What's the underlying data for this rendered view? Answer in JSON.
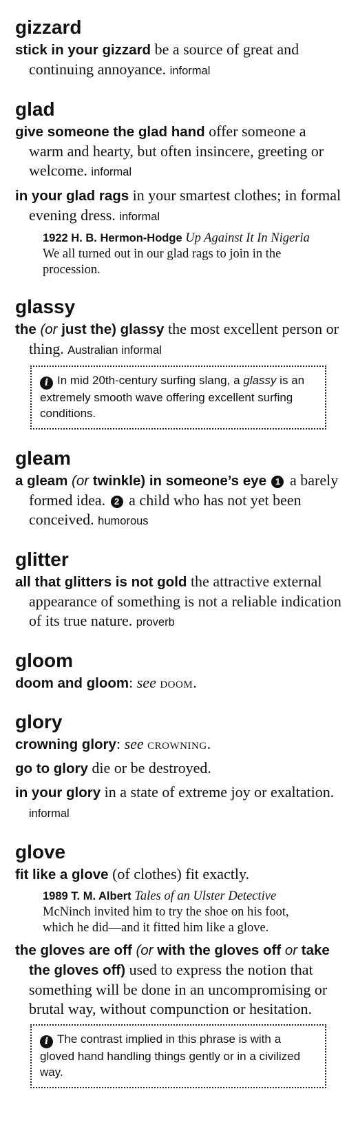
{
  "entries": [
    {
      "headword": "gizzard",
      "senses": [
        {
          "phrase": "stick in your gizzard",
          "definition": " be a source of great and continuing annoyance. ",
          "label": "informal"
        }
      ]
    },
    {
      "headword": "glad",
      "senses": [
        {
          "phrase": "give someone the glad hand",
          "definition": " offer someone a warm and hearty, but often insincere, greeting or welcome. ",
          "label": "informal"
        },
        {
          "phrase": "in your glad rags",
          "definition": " in your smartest clothes; in formal evening dress. ",
          "label": "informal"
        }
      ],
      "quote": {
        "source": "1922 H. B. Hermon-Hodge",
        "title": "Up Against It In Nigeria",
        "text": " We all turned out in our glad rags to join in the procession."
      }
    },
    {
      "headword": "glassy",
      "sense": {
        "phrase_a": "the ",
        "or": "(or",
        "phrase_b": " just the)",
        "phrase_c": " glassy",
        "definition": " the most excellent person or thing. ",
        "label": "Australian informal"
      },
      "note": {
        "icon": "info-icon",
        "text_before": "In mid 20th-century surfing slang, a ",
        "italic": "glassy",
        "text_after": " is an extremely smooth wave offering excellent surfing conditions."
      }
    },
    {
      "headword": "gleam",
      "sense": {
        "phrase_a": "a gleam ",
        "or": "(or",
        "phrase_b": " twinkle)",
        "phrase_c": " in someone’s eye",
        "num1": "1",
        "def1": " a barely formed idea. ",
        "num2": "2",
        "def2": " a child who has not yet been conceived. ",
        "label": "humorous"
      }
    },
    {
      "headword": "glitter",
      "senses": [
        {
          "phrase": "all that glitters is not gold",
          "definition": " the attractive external appearance of something is not a reliable indication of its true nature. ",
          "label": "proverb"
        }
      ]
    },
    {
      "headword": "gloom",
      "xref": {
        "phrase": "doom and gloom",
        "colon": ": ",
        "see": "see ",
        "target": "doom",
        "end": "."
      }
    },
    {
      "headword": "glory",
      "xref": {
        "phrase": "crowning glory",
        "colon": ": ",
        "see": "see ",
        "target": "crowning",
        "end": "."
      },
      "senses": [
        {
          "phrase": "go to glory",
          "definition": " die or be destroyed.",
          "label": ""
        },
        {
          "phrase": "in your glory",
          "definition": " in a state of extreme joy or exaltation. ",
          "label": "informal"
        }
      ]
    },
    {
      "headword": "glove",
      "senses": [
        {
          "phrase": "fit like a glove",
          "definition": " (of clothes) fit exactly.",
          "label": ""
        }
      ],
      "quote": {
        "source": "1989 T. M. Albert",
        "title": "Tales of an Ulster Detective",
        "text": " McNinch invited him to try the shoe on his foot, which he did—and it fitted him like a glove."
      },
      "sense2": {
        "phrase_a": "the gloves are off ",
        "or1": "(or",
        "phrase_b": " with the gloves off ",
        "or2": "or",
        "phrase_c": " take the gloves off)",
        "definition": " used to express the notion that something will be done in an uncompromising or brutal way, without compunction or hesitation."
      },
      "note": {
        "icon": "info-icon",
        "text": "The contrast implied in this phrase is with a gloved hand handling things gently or in a civilized way."
      }
    }
  ]
}
